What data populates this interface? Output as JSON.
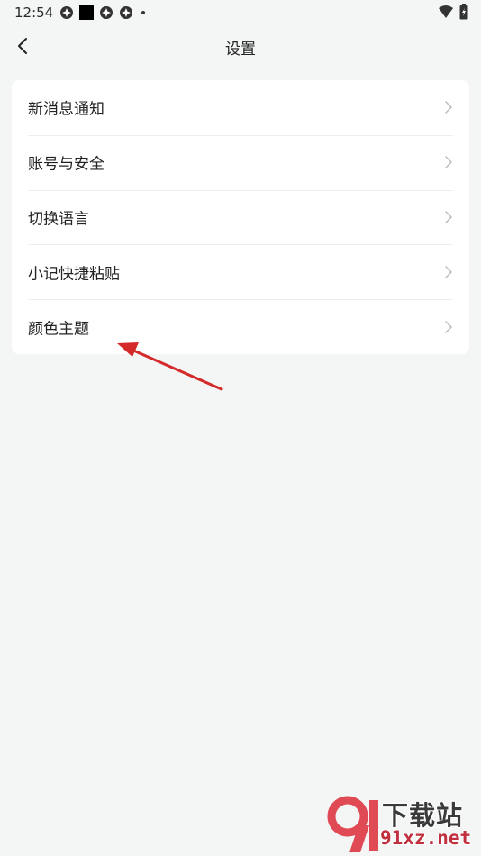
{
  "status_bar": {
    "time": "12:54",
    "left_icons": [
      "app-icon",
      "black-square-icon",
      "app-icon",
      "app-icon",
      "dot-icon"
    ],
    "right_icons": [
      "wifi-icon",
      "battery-icon"
    ]
  },
  "header": {
    "title": "设置",
    "back_icon": "chevron-left-icon"
  },
  "settings": {
    "items": [
      {
        "label": "新消息通知"
      },
      {
        "label": "账号与安全"
      },
      {
        "label": "切换语言"
      },
      {
        "label": "小记快捷粘贴"
      },
      {
        "label": "颜色主题"
      }
    ]
  },
  "annotation": {
    "color": "#d42a2a"
  },
  "watermark": {
    "logo": "91",
    "name": "下载站",
    "domain": "91xz.net"
  },
  "colors": {
    "background": "#f4f5f5",
    "card": "#ffffff",
    "text": "#222222",
    "chevron": "#bbbbbb",
    "accent": "#c0303e"
  }
}
